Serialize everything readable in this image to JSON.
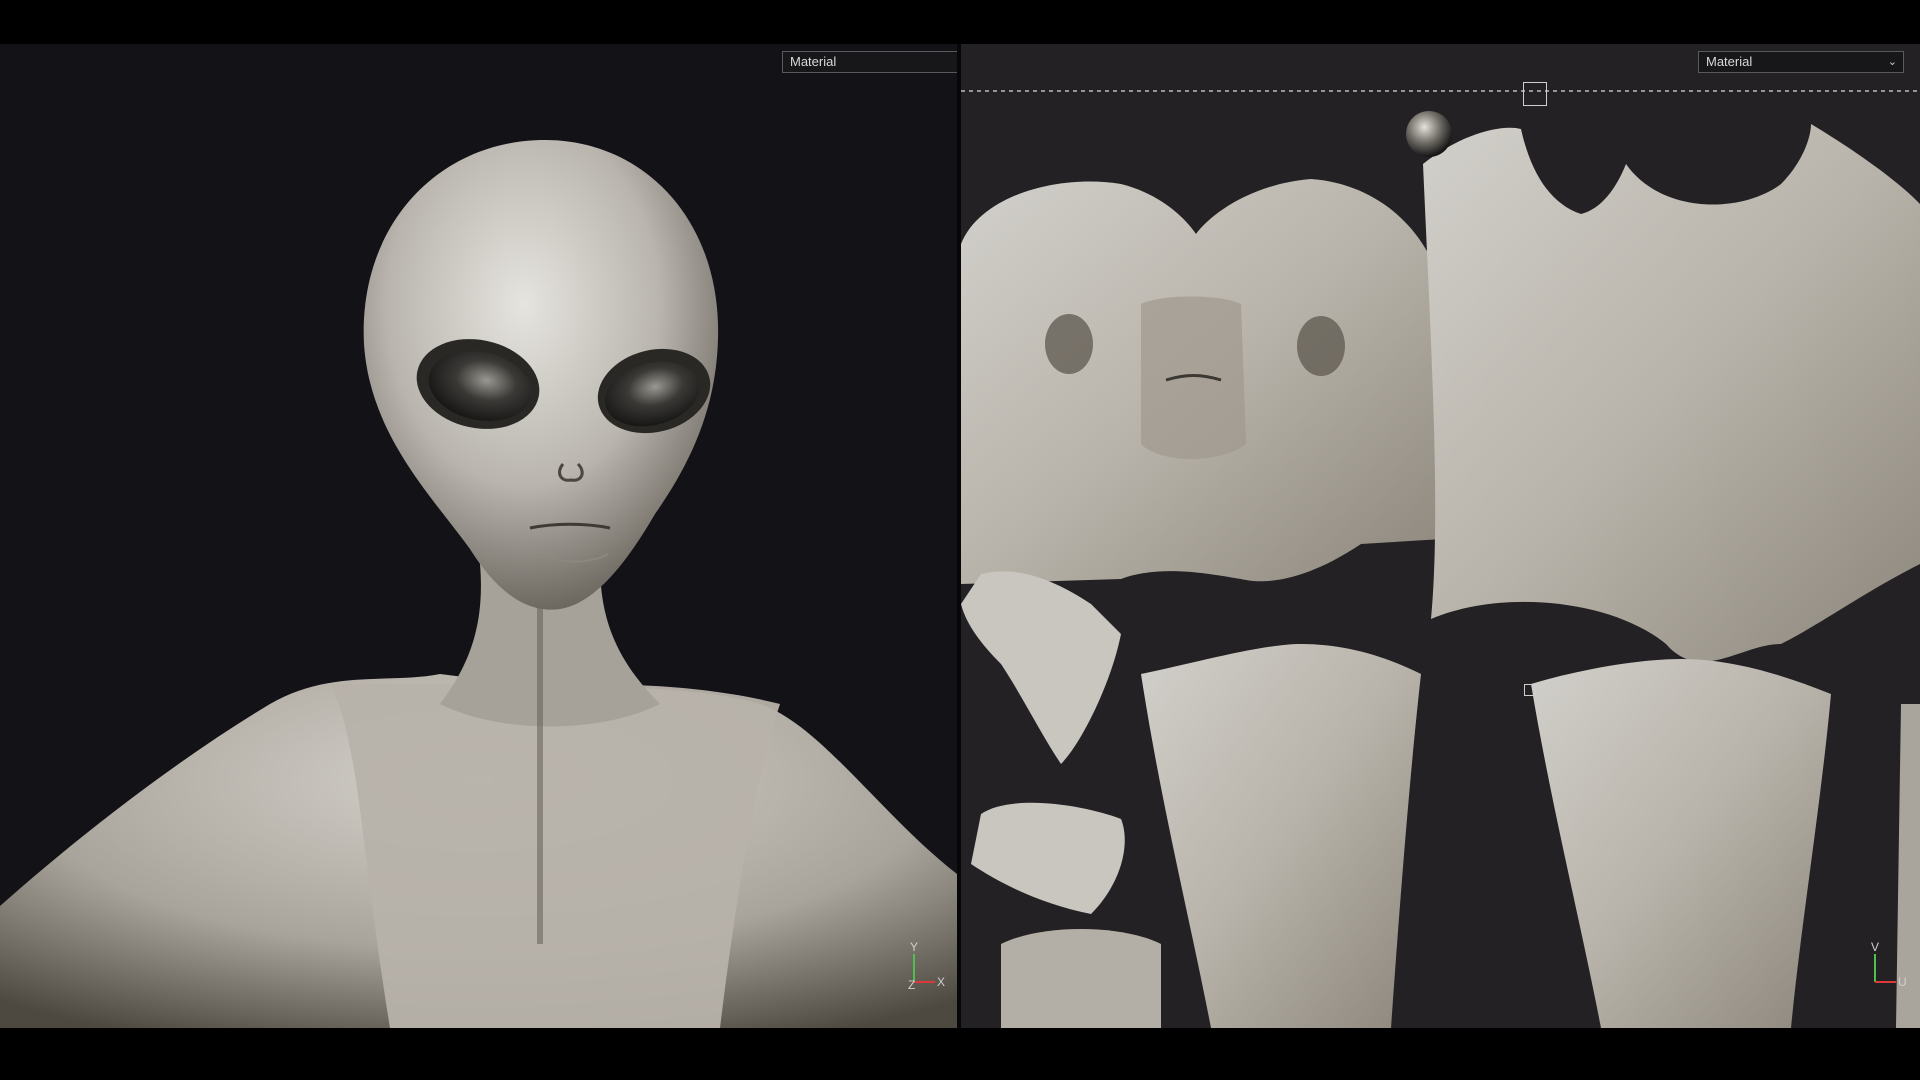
{
  "left_viewport": {
    "shading_mode": "Material",
    "axis_labels": {
      "y": "Y",
      "x": "X",
      "z": "Z"
    }
  },
  "right_viewport": {
    "shading_mode": "Material",
    "axis_labels": {
      "v": "V",
      "u": "U"
    }
  },
  "icons": {
    "dropdown_chevron": "chevron-down-icon",
    "axis_gizmo": "axis-gizmo-icon",
    "material_ball": "material-sphere-icon"
  },
  "colors": {
    "viewport_bg": "#131217",
    "uv_bg": "#232124",
    "axis_x": "#d93a3a",
    "axis_y": "#4fc04f",
    "skin": "#c9c6c0"
  }
}
